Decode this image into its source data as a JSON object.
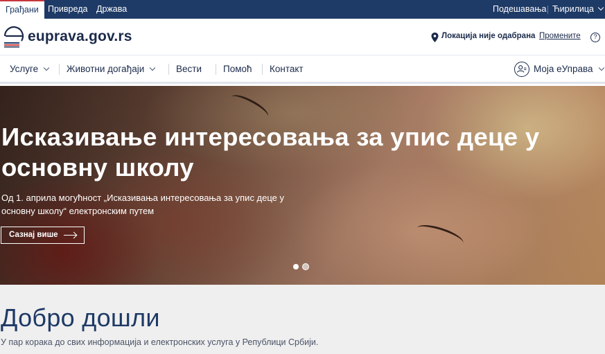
{
  "topbar": {
    "tabs": [
      {
        "label": "Грађани",
        "active": true
      },
      {
        "label": "Привреда",
        "active": false
      },
      {
        "label": "Држава",
        "active": false
      }
    ],
    "settings_label": "Подешавања",
    "script_label": "Ћирилица"
  },
  "header": {
    "logo_text": "euprava.gov.rs",
    "location_text": "Локација није одабрана",
    "change_label": "Промените",
    "help_symbol": "?"
  },
  "nav": {
    "items": [
      {
        "label": "Услуге",
        "has_dropdown": true
      },
      {
        "label": "Животни догађаји",
        "has_dropdown": true
      },
      {
        "label": "Вести",
        "has_dropdown": false
      },
      {
        "label": "Помоћ",
        "has_dropdown": false
      },
      {
        "label": "Контакт",
        "has_dropdown": false
      }
    ],
    "account_label": "Моја еУправа"
  },
  "hero": {
    "title": "Исказивање интересовања за упис деце у основну школу",
    "description": "Од 1. априла могућност „Исказивања интересовања за упис деце у основну школу“ електронским путем",
    "button_label": "Сазнај више",
    "slides_count": 2,
    "active_slide": 1
  },
  "welcome": {
    "title": "Добро дошли",
    "subtitle": "У пар корака до свих информација и електронских услуга у Републици Србији."
  },
  "colors": {
    "primary": "#1e3a66",
    "accent": "#c6363c",
    "welcome_bg": "#efefef"
  },
  "icons": [
    "location-pin-icon",
    "help-icon",
    "chevron-down-icon",
    "account-icon",
    "arrow-right-icon",
    "eu-logo-icon"
  ]
}
